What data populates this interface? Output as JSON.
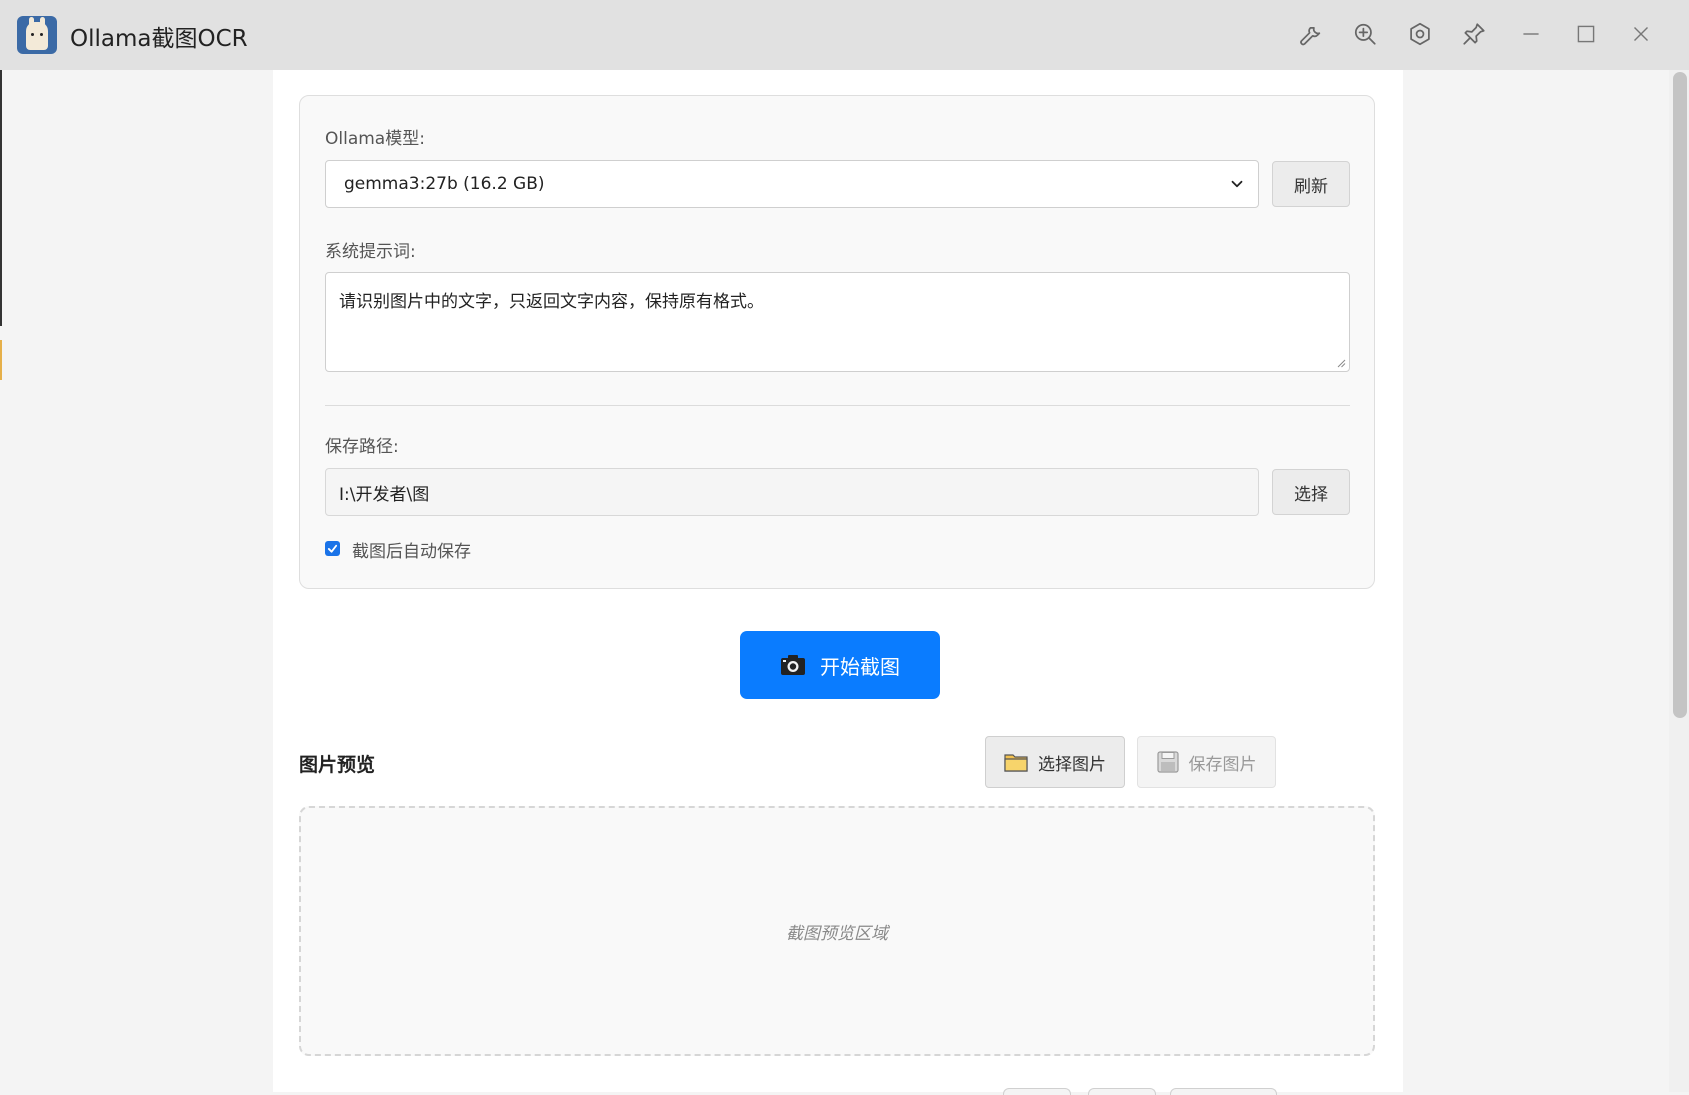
{
  "window": {
    "title": "Ollama截图OCR",
    "toolbar_icons": [
      "wrench-icon",
      "zoom-in-icon",
      "settings-icon",
      "pin-icon"
    ],
    "controls": [
      "minimize-icon",
      "maximize-icon",
      "close-icon"
    ]
  },
  "settings": {
    "model_label": "Ollama模型:",
    "model_value": "gemma3:27b (16.2 GB)",
    "refresh_label": "刷新",
    "prompt_label": "系统提示词:",
    "prompt_value": "请识别图片中的文字，只返回文字内容，保持原有格式。",
    "path_label": "保存路径:",
    "path_value": "I:\\开发者\\图",
    "choose_label": "选择",
    "autosave_label": "截图后自动保存",
    "autosave_checked": true
  },
  "capture": {
    "start_label": "开始截图",
    "start_icon": "camera-icon",
    "accent": "#0a7cff"
  },
  "preview": {
    "title": "图片预览",
    "select_image_label": "选择图片",
    "select_image_icon": "folder-icon",
    "save_image_label": "保存图片",
    "save_image_icon": "floppy-disk-icon",
    "placeholder": "截图预览区域"
  }
}
